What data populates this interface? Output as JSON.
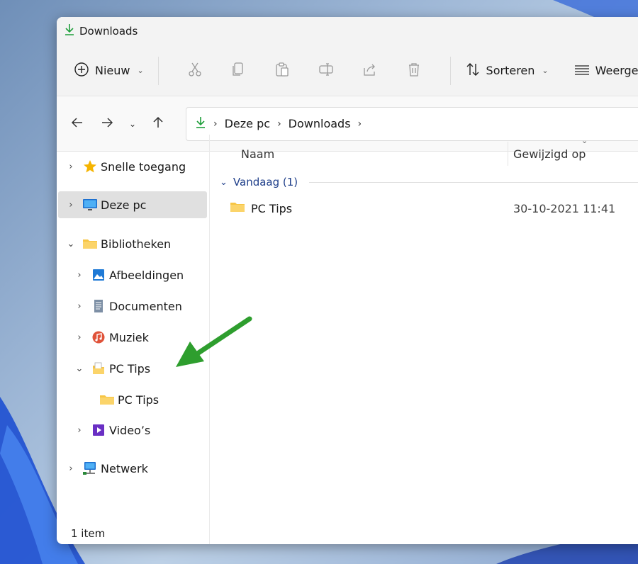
{
  "window": {
    "title": "Downloads"
  },
  "toolbar": {
    "new_label": "Nieuw",
    "sort_label": "Sorteren",
    "view_label": "Weergev"
  },
  "address": {
    "crumbs": [
      "Deze pc",
      "Downloads"
    ]
  },
  "sidebar": {
    "items": [
      {
        "label": "Snelle toegang"
      },
      {
        "label": "Deze pc"
      },
      {
        "label": "Bibliotheken"
      },
      {
        "label": "Afbeeldingen"
      },
      {
        "label": "Documenten"
      },
      {
        "label": "Muziek"
      },
      {
        "label": "PC Tips"
      },
      {
        "label": "PC Tips"
      },
      {
        "label": "Video’s"
      },
      {
        "label": "Netwerk"
      }
    ]
  },
  "columns": {
    "name": "Naam",
    "modified": "Gewijzigd op"
  },
  "group": {
    "label": "Vandaag (1)"
  },
  "files": [
    {
      "name": "PC Tips",
      "modified": "30-10-2021 11:41"
    }
  ],
  "status": {
    "text": "1 item"
  },
  "colors": {
    "accent_green": "#1e9e3a",
    "folder_yellow": "#f7c544",
    "group_blue": "#1f3f8a",
    "selected_bg": "#e0e0e0",
    "annotation_arrow": "#2e9e2e"
  }
}
